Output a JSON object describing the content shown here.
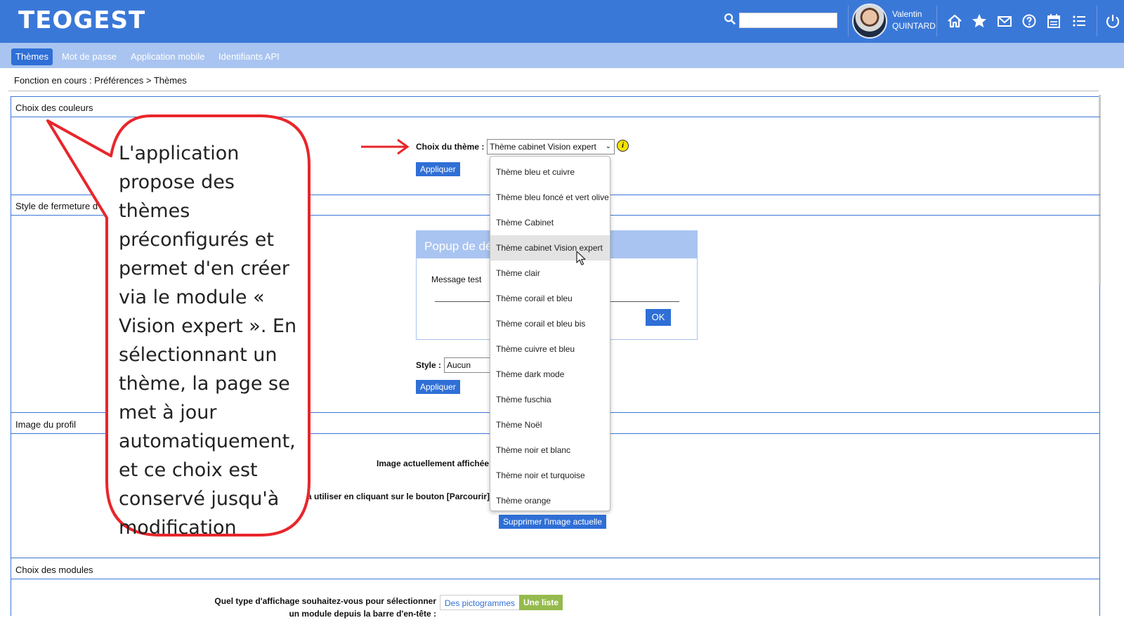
{
  "header": {
    "logo": "TEOGEST",
    "user_first": "Valentin",
    "user_last": "QUINTARD",
    "brand_color": "#3a78d8",
    "icons": [
      "search-icon",
      "home-icon",
      "star-icon",
      "mail-icon",
      "help-icon",
      "calendar-icon",
      "list-icon",
      "power-icon"
    ]
  },
  "nav": {
    "items": [
      "Thèmes",
      "Mot de passe",
      "Application mobile",
      "Identifiants API"
    ],
    "active": "Thèmes"
  },
  "breadcrumb": "Fonction en cours :  Préférences > Thèmes",
  "sections": {
    "couleurs": {
      "title": "Choix des couleurs",
      "theme_label": "Choix du thème :",
      "theme_value": "Thème cabinet Vision expert",
      "apply": "Appliquer"
    },
    "fermeture": {
      "title": "Style de fermeture d",
      "popup_title": "Popup de dé",
      "popup_message": "Message test",
      "popup_ok": "OK",
      "style_label": "Style :",
      "style_value": "Aucun",
      "apply": "Appliquer"
    },
    "profil": {
      "title": "Image du profil",
      "current_label": "Image actuellement affichée",
      "browse_label": "à utiliser en cliquant sur le bouton [Parcourir]",
      "delete_button": "Supprimer l'image actuelle"
    },
    "modules": {
      "title": "Choix des modules",
      "question_line1": "Quel type d'affichage souhaitez-vous pour sélectionner",
      "question_line2": "un module depuis la barre d'en-tête :",
      "option_picto": "Des pictogrammes",
      "option_list": "Une liste"
    }
  },
  "dropdown": {
    "items": [
      "Thème bleu et cuivre",
      "Thème bleu foncé et vert olive",
      "Thème Cabinet",
      "Thème cabinet Vision expert",
      "Thème clair",
      "Thème corail et bleu",
      "Thème corail et bleu bis",
      "Thème cuivre et bleu",
      "Thème dark mode",
      "Thème fuschia",
      "Thème Noël",
      "Thème noir et blanc",
      "Thème noir et turquoise",
      "Thème orange"
    ],
    "hovered": "Thème cabinet Vision expert"
  },
  "annotation": {
    "text": "L'application propose des thèmes préconfigurés et permet d'en créer via le module « Vision expert ». En sélectionnant un thème, la page se met à jour automatiquement, et ce choix est conservé jusqu'à modification",
    "color": "#e8262b"
  }
}
